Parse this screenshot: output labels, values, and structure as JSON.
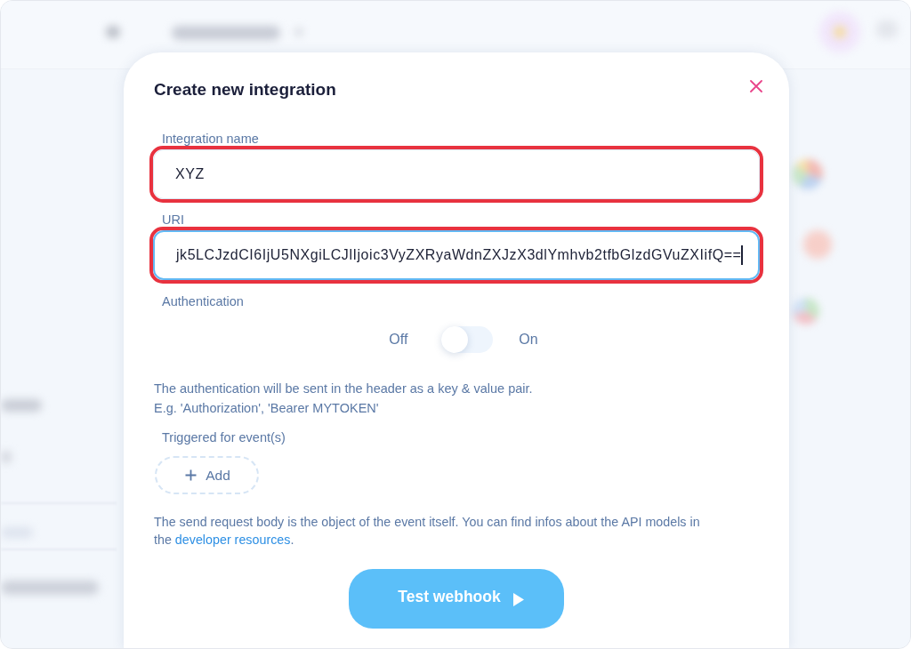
{
  "modal": {
    "title": "Create new integration",
    "fields": [
      {
        "label": "Integration name",
        "value": "XYZ",
        "focused": false,
        "highlighted": true
      },
      {
        "label": "URI",
        "value": "jk5LCJzdCI6IjU5NXgiLCJlIjoic3VyZXRyaWdnZXJzX3dlYmhvb2tfbGlzdGVuZXIifQ==",
        "focused": true,
        "highlighted": true
      }
    ],
    "authentication": {
      "label": "Authentication",
      "off_label": "Off",
      "on_label": "On",
      "on": false,
      "hint": [
        "The authentication will be sent in the header as a key & value pair.",
        "E.g. 'Authorization', 'Bearer MYTOKEN'"
      ]
    },
    "events": {
      "label": "Triggered for event(s)",
      "add_button": "Add"
    },
    "note": {
      "text": "The send request body is the object of the event itself. You can find infos about the API models in the",
      "link": "developer resources",
      "after": "."
    },
    "test_button": "Test webhook"
  }
}
